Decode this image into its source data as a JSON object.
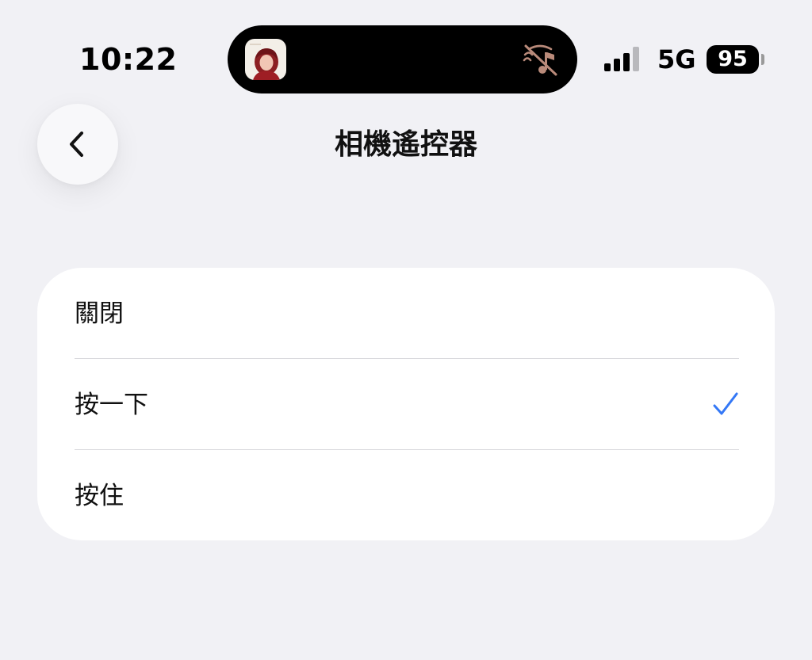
{
  "status_bar": {
    "time": "10:22",
    "network": "5G",
    "battery": "95",
    "signal_icon": "cellular-signal-icon",
    "mute_icon": "muted-bell-icon",
    "album_icon": "now-playing-album-art"
  },
  "header": {
    "back_icon": "chevron-left-icon",
    "title": "相機遙控器"
  },
  "options": [
    {
      "label": "關閉",
      "selected": false
    },
    {
      "label": "按一下",
      "selected": true
    },
    {
      "label": "按住",
      "selected": false
    }
  ],
  "colors": {
    "background": "#f1f1f5",
    "card": "#ffffff",
    "accent": "#3478f6",
    "muted_icon": "#b98a7a"
  }
}
